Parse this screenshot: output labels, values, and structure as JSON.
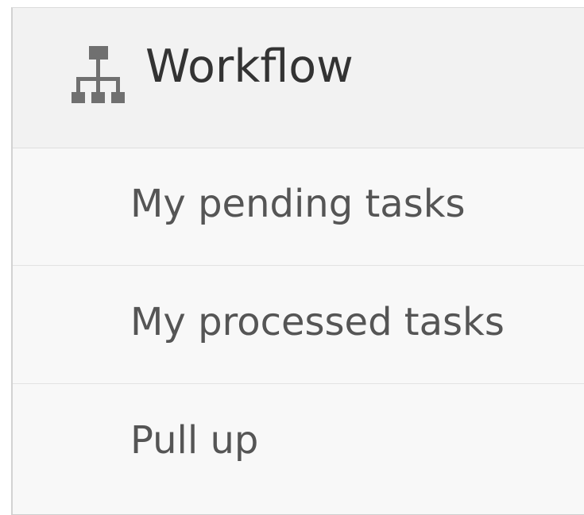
{
  "panel": {
    "title": "Workflow",
    "icon": "sitemap-icon"
  },
  "menu": {
    "items": [
      {
        "label": "My pending tasks"
      },
      {
        "label": "My processed tasks"
      },
      {
        "label": "Pull up"
      }
    ]
  },
  "colors": {
    "header_bg": "#f2f2f2",
    "item_bg": "#f8f8f8",
    "title_text": "#333333",
    "item_text": "#555555",
    "icon": "#707070"
  }
}
